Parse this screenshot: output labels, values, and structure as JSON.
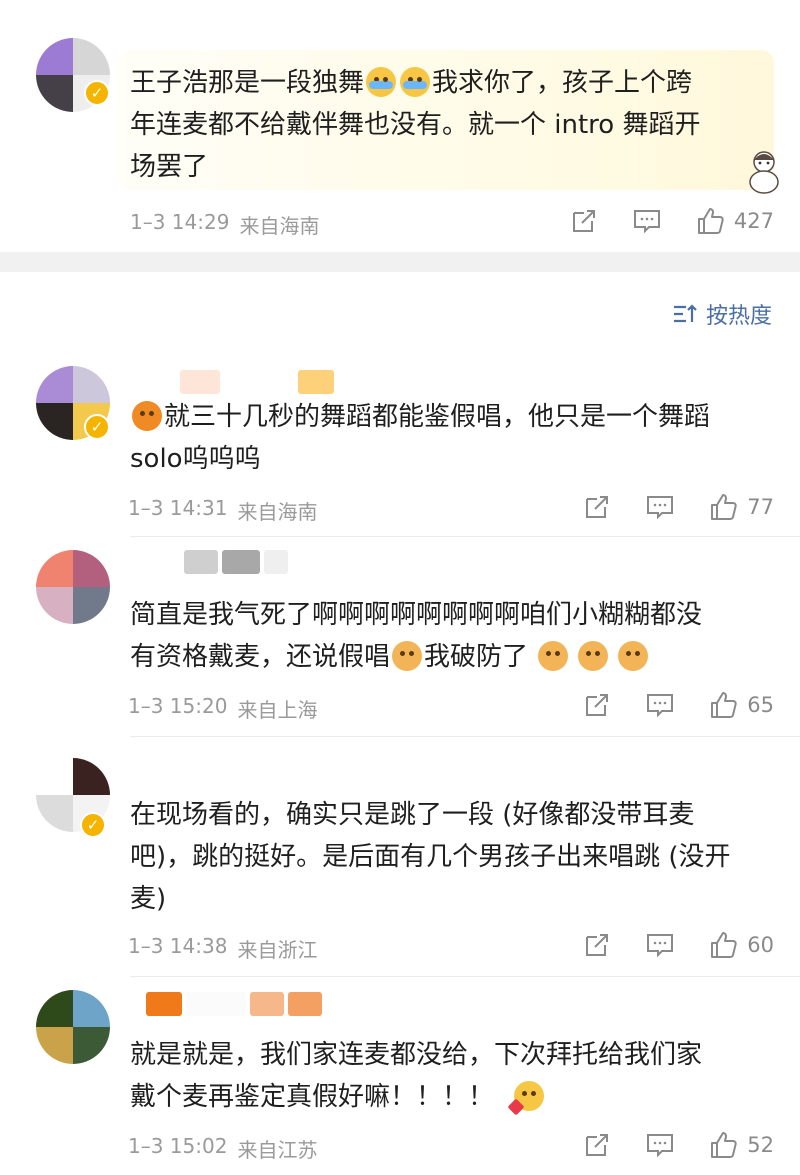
{
  "pinned": {
    "text": "王子浩那是一段独舞😂😂我求你了，孩子上个跨年连麦都不给戴伴舞也没有。就一个 intro 舞蹈开场罢了",
    "text_a": "王子浩那是一段独舞",
    "text_b": "我求你了，孩子上个跨",
    "text_c": "年连麦都不给戴伴舞也没有。就一个 intro 舞蹈开",
    "text_d": "场罢了",
    "time": "1–3 14:29",
    "location": "来自海南",
    "likes": "427"
  },
  "sort": {
    "label": "按热度"
  },
  "comments": [
    {
      "line1": "就三十几秒的舞蹈都能鉴假唱，他只是一个舞蹈",
      "line2": "solo呜呜呜",
      "time": "1–3 14:31",
      "location": "来自海南",
      "likes": "77"
    },
    {
      "line1": "简直是我气死了啊啊啊啊啊啊啊啊咱们小糊糊都没",
      "line2a": "有资格戴麦，还说假唱",
      "line2b": "我破防了",
      "time": "1–3 15:20",
      "location": "来自上海",
      "likes": "65"
    },
    {
      "line1": "在现场看的，确实只是跳了一段 (好像都没带耳麦",
      "line2": "吧)，跳的挺好。是后面有几个男孩子出来唱跳 (没开",
      "line3": "麦)",
      "time": "1–3 14:38",
      "location": "来自浙江",
      "likes": "60"
    },
    {
      "line1": "就是就是，我们家连麦都没给，下次拜托给我们家",
      "line2": "戴个麦再鉴定真假好嘛！！！！",
      "time": "1–3 15:02",
      "location": "来自江苏",
      "likes": "52"
    }
  ],
  "colors": {
    "accent": "#4a6fa5",
    "meta": "#9a9a9a",
    "badge": "#f5b400"
  },
  "icons": [
    "share-icon",
    "comment-icon",
    "like-icon",
    "sort-icon",
    "verified-badge",
    "emoji-laugh-cry",
    "emoji-angry",
    "emoji-dog-cry",
    "emoji-heart"
  ]
}
